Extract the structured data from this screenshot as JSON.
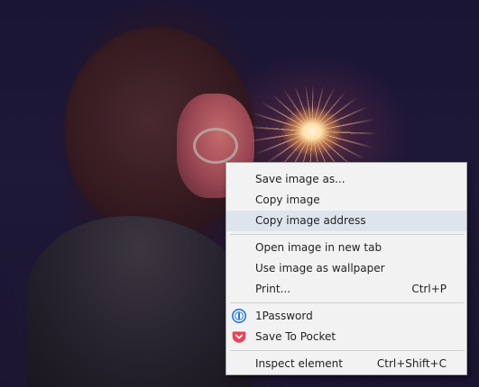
{
  "background": {
    "description_icon": "photo-person-with-sparkler"
  },
  "context_menu": {
    "groups": [
      [
        {
          "label": "Save image as...",
          "shortcut": "",
          "icon": ""
        },
        {
          "label": "Copy image",
          "shortcut": "",
          "icon": ""
        },
        {
          "label": "Copy image address",
          "shortcut": "",
          "icon": "",
          "highlighted": true
        }
      ],
      [
        {
          "label": "Open image in new tab",
          "shortcut": "",
          "icon": ""
        },
        {
          "label": "Use image as wallpaper",
          "shortcut": "",
          "icon": ""
        },
        {
          "label": "Print...",
          "shortcut": "Ctrl+P",
          "icon": ""
        }
      ],
      [
        {
          "label": "1Password",
          "shortcut": "",
          "icon": "1password-icon"
        },
        {
          "label": "Save To Pocket",
          "shortcut": "",
          "icon": "pocket-icon"
        }
      ],
      [
        {
          "label": "Inspect element",
          "shortcut": "Ctrl+Shift+C",
          "icon": ""
        }
      ]
    ]
  },
  "colors": {
    "menu_bg": "#f2f2f2",
    "highlight": "#dde4ee",
    "pocket_red": "#ef4056",
    "onepassword_blue": "#1a73e8"
  }
}
